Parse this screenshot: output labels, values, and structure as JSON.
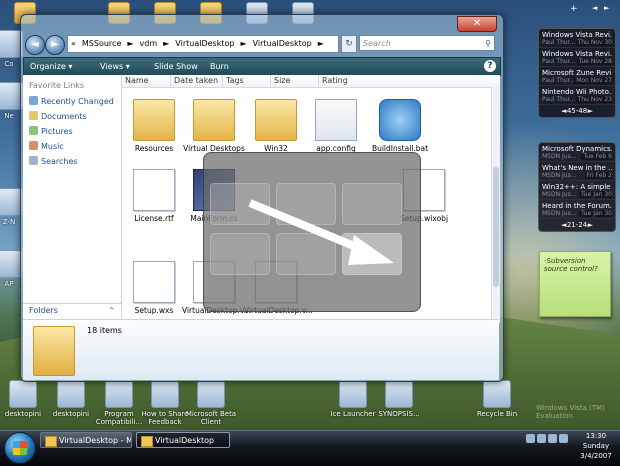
{
  "window": {
    "close_glyph": "✕",
    "back_glyph": "◄",
    "forward_glyph": "►",
    "address_prefix": "«",
    "breadcrumb": [
      "MSSource",
      "vdm",
      "VirtualDesktop",
      "VirtualDesktop"
    ],
    "breadcrumb_sep": "►",
    "refresh_glyph": "↻",
    "search_placeholder": "Search",
    "search_glyph": "⚲"
  },
  "toolbar": {
    "organize": "Organize ▾",
    "views": "Views ▾",
    "slideshow": "Slide Show",
    "burn": "Burn",
    "help": "?"
  },
  "nav_pane": {
    "heading": "Favorite Links",
    "links": [
      "Recently Changed",
      "Documents",
      "Pictures",
      "Music",
      "Searches"
    ],
    "folders_label": "Folders",
    "folders_glyph": "⌃"
  },
  "columns": [
    "Name",
    "Date taken",
    "Tags",
    "Size",
    "Rating"
  ],
  "files": [
    {
      "label": "Resources",
      "kind": "folder"
    },
    {
      "label": "Virtual Desktops",
      "kind": "folder"
    },
    {
      "label": "Win32",
      "kind": "folder"
    },
    {
      "label": "app.config",
      "kind": "cfg"
    },
    {
      "label": "BuildInstall.bat",
      "kind": "gear"
    },
    {
      "label": "License.rtf",
      "kind": "doc"
    },
    {
      "label": "MainForm.cs",
      "kind": "sel"
    },
    {
      "label": "Setup.wxs",
      "kind": "doc"
    },
    {
      "label": "VirtualDesktop.v...",
      "kind": "doc"
    },
    {
      "label": "VirtualDesktop.v...",
      "kind": "doc"
    },
    {
      "label": "Setup.wixobj",
      "kind": "doc"
    }
  ],
  "details": {
    "count": "18 items"
  },
  "desktop_icons": [
    "Co",
    "Ne",
    "Z-N",
    "AP",
    "desktopini",
    "desktopini",
    "Program Compatibili...",
    "How to Share Feedback",
    "Microsoft Beta Client",
    "Ice Launcher",
    "SYNOPSIS...",
    "Recycle Bin"
  ],
  "gadgets": {
    "controls": [
      "+",
      "◄",
      "►"
    ],
    "feed1": [
      {
        "title": "Windows Vista Revi...",
        "meta": "Paul Thur...",
        "date": "Thu Nov 30"
      },
      {
        "title": "Windows Vista Revi...",
        "meta": "Paul Thur...",
        "date": "Tue Nov 28"
      },
      {
        "title": "Microsoft Zune Revi...",
        "meta": "Paul Thur...",
        "date": "Mon Nov 27"
      },
      {
        "title": "Nintendo Wii Photo...",
        "meta": "Paul Thur...",
        "date": "Thu Nov 23"
      }
    ],
    "feed1_pager": "45-48",
    "feed2": [
      {
        "title": "Microsoft Dynamics...",
        "meta": "MSDN Jus...",
        "date": "Tue Feb 6"
      },
      {
        "title": "What's New in the ...",
        "meta": "MSDN Jus...",
        "date": "Fri Feb 2"
      },
      {
        "title": "Win32++: A simple ...",
        "meta": "MSDN Jus...",
        "date": "Tue Jan 30"
      },
      {
        "title": "Heard in the Forum...",
        "meta": "MSDN Jus...",
        "date": "Tue Jan 30"
      }
    ],
    "feed2_pager": "21-24",
    "pager_prev": "◄",
    "pager_next": "►",
    "note": "-Subversion source control?"
  },
  "brand": "Windows Vista (TM) Evaluation",
  "taskbar": {
    "buttons": [
      {
        "label": "VirtualDesktop - Mi...",
        "state": "normal"
      },
      {
        "label": "VirtualDesktop",
        "state": "active"
      }
    ],
    "time": "13:30",
    "day": "Sunday",
    "date": "3/4/2007"
  }
}
